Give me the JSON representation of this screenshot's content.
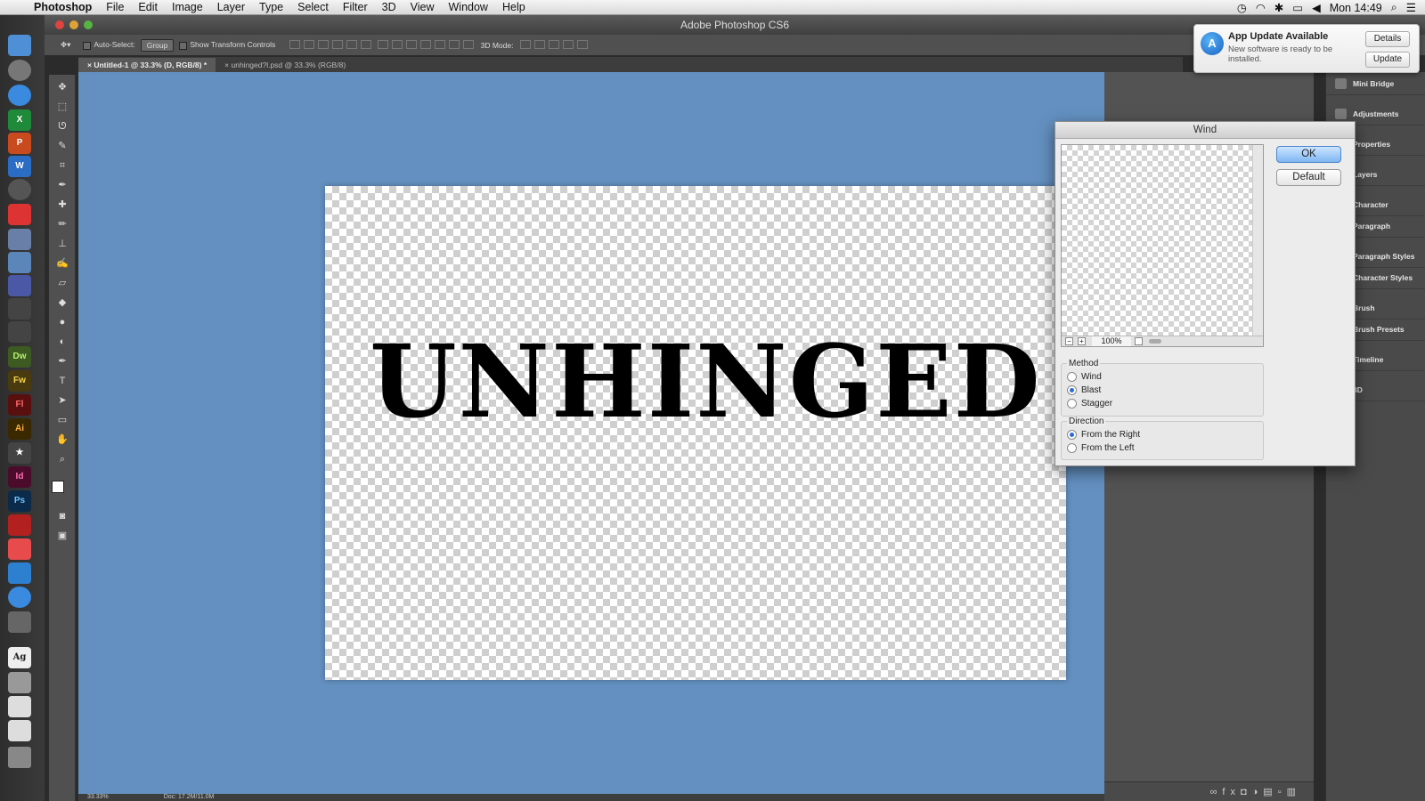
{
  "menubar": {
    "app_name": "Photoshop",
    "items": [
      "File",
      "Edit",
      "Image",
      "Layer",
      "Type",
      "Select",
      "Filter",
      "3D",
      "View",
      "Window",
      "Help"
    ],
    "clock": "Mon 14:49"
  },
  "window": {
    "title": "Adobe Photoshop CS6"
  },
  "options_bar": {
    "auto_select_label": "Auto-Select:",
    "auto_select_value": "Group",
    "transform_label": "Show Transform Controls",
    "mode_3d_label": "3D Mode:"
  },
  "tabs": [
    {
      "label": "Untitled-1 @ 33.3% (D, RGB/8) *",
      "active": true
    },
    {
      "label": "unhinged?l.psd @ 33.3% (RGB/8)",
      "active": false
    }
  ],
  "canvas": {
    "text": "UNHINGED"
  },
  "status": {
    "zoom": "33.33%",
    "doc": "Doc: 17.2M/11.0M"
  },
  "notification": {
    "title": "App Update Available",
    "body": "New software is ready to be installed.",
    "details_label": "Details",
    "update_label": "Update"
  },
  "wind_dialog": {
    "title": "Wind",
    "ok_label": "OK",
    "default_label": "Default",
    "zoom": "100%",
    "method_label": "Method",
    "methods": [
      "Wind",
      "Blast",
      "Stagger"
    ],
    "method_selected": "Blast",
    "direction_label": "Direction",
    "directions": [
      "From the Right",
      "From the Left"
    ],
    "direction_selected": "From the Right"
  },
  "panels": [
    "Mini Bridge",
    "Adjustments",
    "Properties",
    "Layers",
    "Character",
    "Paragraph",
    "Paragraph Styles",
    "Character Styles",
    "Brush",
    "Brush Presets",
    "Timeline",
    "3D"
  ],
  "dock_apps": [
    "Dw",
    "Fw",
    "Fl",
    "Ai",
    "Id",
    "Ps"
  ],
  "colors": {
    "pasteboard": "#6390c0",
    "ui_dark": "#505050",
    "accent": "#2a6ad8"
  }
}
